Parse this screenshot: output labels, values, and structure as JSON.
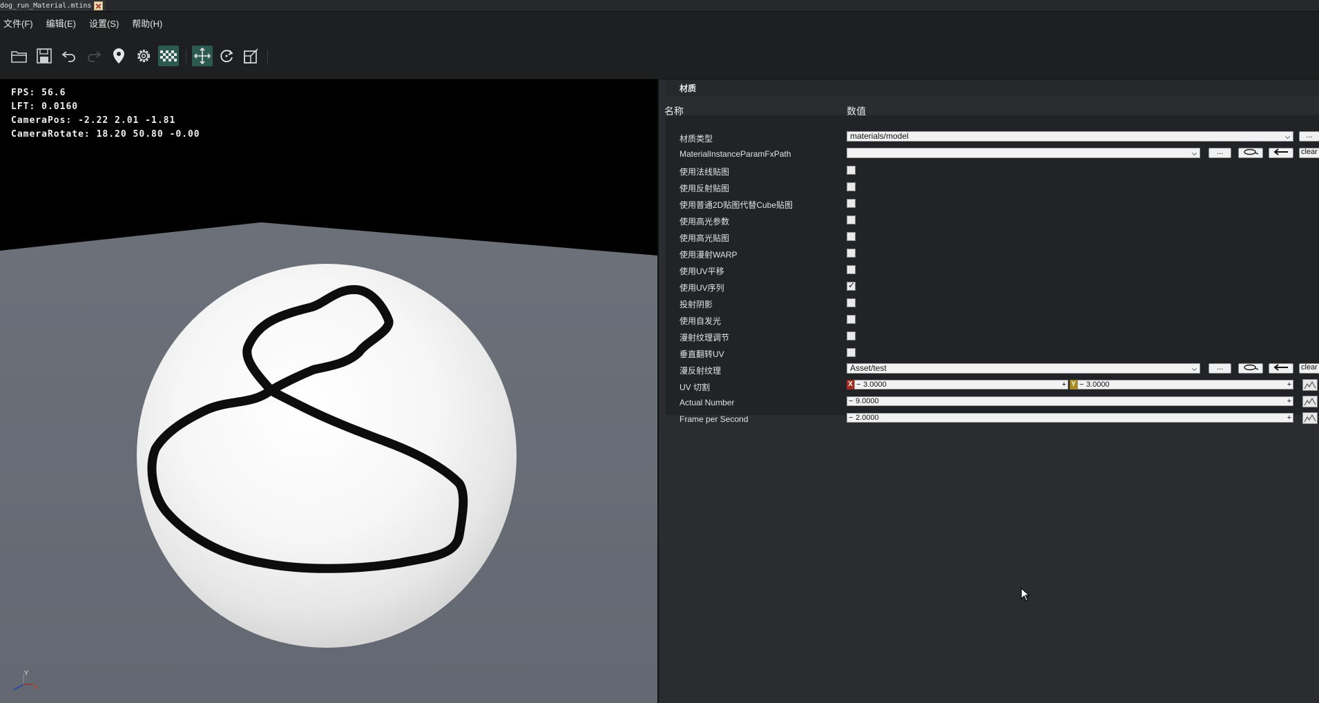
{
  "tab": {
    "title": "dog_run_Material.mtins"
  },
  "menu": [
    {
      "label": "文件(F)"
    },
    {
      "label": "编辑(E)"
    },
    {
      "label": "设置(S)"
    },
    {
      "label": "帮助(H)"
    }
  ],
  "toolbar": {
    "icons": [
      "open-folder-icon",
      "save-icon",
      "undo-icon",
      "redo-icon",
      "location-pin-icon",
      "settings-gear-icon",
      "checkerboard-icon",
      "move-arrows-icon",
      "rotate-icon",
      "scale-icon"
    ],
    "active": [
      "checkerboard-icon",
      "move-arrows-icon"
    ]
  },
  "viewport": {
    "hud": {
      "fps": "FPS: 56.6",
      "lft": "LFT: 0.0160",
      "camera_pos": "CameraPos: -2.22 2.01 -1.81",
      "camera_rotate": "CameraRotate: 18.20 50.80 -0.00"
    },
    "axis": {
      "x": "X",
      "y": "Y"
    }
  },
  "panel": {
    "section_title": "材质",
    "col_name": "名称",
    "col_value": "数值",
    "rows": [
      {
        "label": "材质类型",
        "type": "combo",
        "value": "materials/model",
        "button": "..."
      },
      {
        "label": "MaterialInstanceParamFxPath",
        "type": "combo-browse",
        "value": "",
        "button": "...",
        "clear": "clear"
      },
      {
        "label": "使用法线贴图",
        "type": "check",
        "checked": false
      },
      {
        "label": "使用反射贴图",
        "type": "check",
        "checked": false
      },
      {
        "label": "使用普通2D贴图代替Cube贴图",
        "type": "check",
        "checked": false
      },
      {
        "label": "使用高光参数",
        "type": "check",
        "checked": false
      },
      {
        "label": "使用高光贴图",
        "type": "check",
        "checked": false
      },
      {
        "label": "使用漫射WARP",
        "type": "check",
        "checked": false
      },
      {
        "label": "使用UV平移",
        "type": "check",
        "checked": false
      },
      {
        "label": "使用UV序列",
        "type": "check",
        "checked": true
      },
      {
        "label": "投射阴影",
        "type": "check",
        "checked": false
      },
      {
        "label": "使用自发光",
        "type": "check",
        "checked": false
      },
      {
        "label": "漫射纹理调节",
        "type": "check",
        "checked": false
      },
      {
        "label": "垂直翻转UV",
        "type": "check",
        "checked": false
      },
      {
        "label": "漫反射纹理",
        "type": "combo-browse",
        "value": "Asset/test",
        "button": "...",
        "clear": "clear"
      },
      {
        "label": "UV 切割",
        "type": "vec2",
        "x_tag": "X",
        "x": "3.0000",
        "y_tag": "Y",
        "y": "3.0000"
      },
      {
        "label": "Actual Number",
        "type": "spin",
        "value": "9.0000"
      },
      {
        "label": "Frame per Second",
        "type": "spin",
        "value": "2.0000"
      }
    ]
  },
  "colors": {
    "accent_active": "#2d5a50",
    "floor": "#6b6f78",
    "panel_bg": "#2b2c2f"
  }
}
